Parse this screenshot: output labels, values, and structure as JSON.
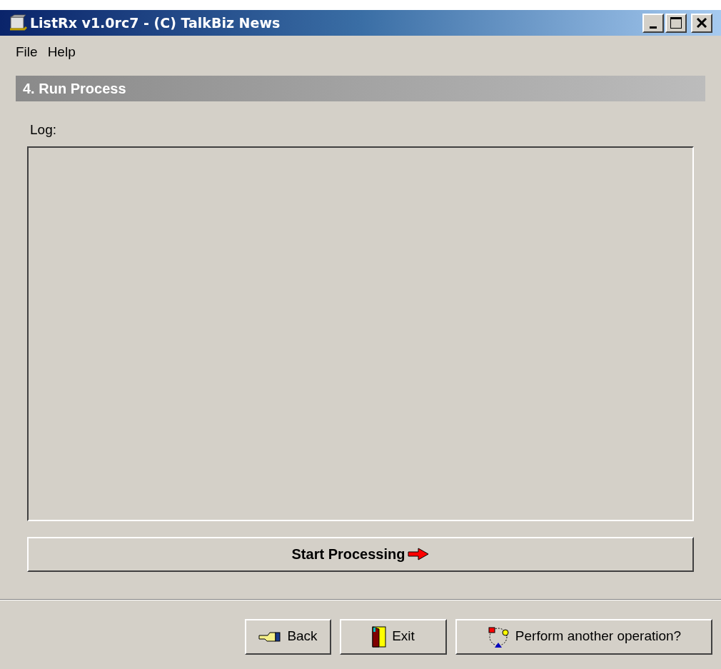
{
  "window": {
    "title": "ListRx v1.0rc7 - (C) TalkBiz News"
  },
  "menu": [
    "File",
    "Help"
  ],
  "section": {
    "title": "4. Run Process"
  },
  "log": {
    "label": "Log:"
  },
  "start_button": {
    "label": "Start Processing"
  },
  "buttons": [
    {
      "kind": "back",
      "label": "Back"
    },
    {
      "kind": "exit",
      "label": "Exit"
    },
    {
      "kind": "another",
      "label": "Perform another operation?"
    }
  ]
}
